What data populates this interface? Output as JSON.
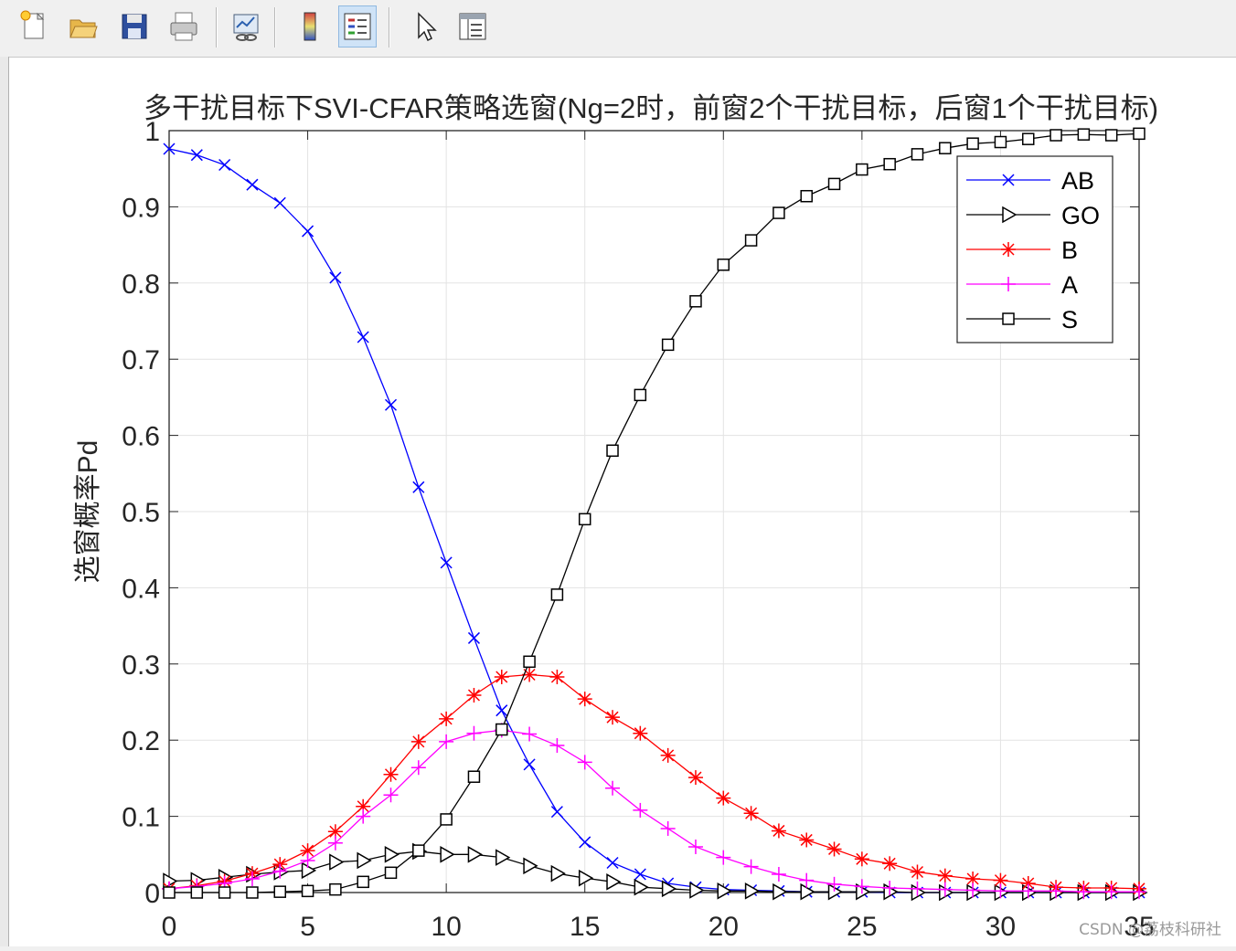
{
  "toolbar": {
    "buttons": [
      {
        "name": "new-figure-icon"
      },
      {
        "name": "open-file-icon"
      },
      {
        "name": "save-icon"
      },
      {
        "name": "print-icon"
      },
      {
        "name": "link-plot-icon"
      },
      {
        "name": "insert-colorbar-icon"
      },
      {
        "name": "insert-legend-icon",
        "active": true
      },
      {
        "name": "edit-plot-pointer-icon"
      },
      {
        "name": "property-inspector-icon"
      }
    ]
  },
  "watermark": "CSDN @荔枝科研社",
  "chart_data": {
    "type": "line",
    "title": "多干扰目标下SVI-CFAR策略选窗(Ng=2时，前窗2个干扰目标，后窗1个干扰目标)",
    "xlabel": "",
    "ylabel": "选窗概率Pd",
    "xlim": [
      0,
      35
    ],
    "ylim": [
      0,
      1
    ],
    "xticks": [
      0,
      5,
      10,
      15,
      20,
      25,
      30,
      35
    ],
    "yticks": [
      0,
      0.1,
      0.2,
      0.3,
      0.4,
      0.5,
      0.6,
      0.7,
      0.8,
      0.9,
      1
    ],
    "grid": true,
    "legend_position": "top-right",
    "x": [
      0,
      1,
      2,
      3,
      4,
      5,
      6,
      7,
      8,
      9,
      10,
      11,
      12,
      13,
      14,
      15,
      16,
      17,
      18,
      19,
      20,
      21,
      22,
      23,
      24,
      25,
      26,
      27,
      28,
      29,
      30,
      31,
      32,
      33,
      34,
      35
    ],
    "series": [
      {
        "name": "AB",
        "color": "#0000ff",
        "marker": "x",
        "values": [
          0.976,
          0.968,
          0.955,
          0.929,
          0.905,
          0.868,
          0.807,
          0.729,
          0.64,
          0.532,
          0.433,
          0.334,
          0.239,
          0.168,
          0.106,
          0.066,
          0.039,
          0.024,
          0.012,
          0.007,
          0.004,
          0.003,
          0.002,
          0.001,
          0.001,
          0.001,
          0.0,
          0.0,
          0.0,
          0.0,
          0.0,
          0.0,
          0.0,
          0.0,
          0.0,
          0.0
        ]
      },
      {
        "name": "GO",
        "color": "#000000",
        "marker": "triangle-right",
        "values": [
          0.015,
          0.016,
          0.02,
          0.024,
          0.027,
          0.029,
          0.04,
          0.042,
          0.05,
          0.054,
          0.05,
          0.05,
          0.046,
          0.035,
          0.025,
          0.019,
          0.014,
          0.007,
          0.005,
          0.003,
          0.002,
          0.002,
          0.001,
          0.001,
          0.001,
          0.001,
          0.001,
          0.0,
          0.0,
          0.0,
          0.0,
          0.0,
          0.0,
          0.0,
          0.0,
          0.0
        ]
      },
      {
        "name": "B",
        "color": "#ff0000",
        "marker": "asterisk",
        "values": [
          0.005,
          0.009,
          0.015,
          0.025,
          0.037,
          0.055,
          0.08,
          0.113,
          0.155,
          0.198,
          0.228,
          0.259,
          0.283,
          0.286,
          0.283,
          0.254,
          0.23,
          0.209,
          0.18,
          0.151,
          0.124,
          0.104,
          0.081,
          0.069,
          0.057,
          0.044,
          0.038,
          0.027,
          0.022,
          0.018,
          0.016,
          0.012,
          0.007,
          0.006,
          0.006,
          0.005
        ]
      },
      {
        "name": "A",
        "color": "#ff00ff",
        "marker": "plus",
        "values": [
          0.005,
          0.008,
          0.012,
          0.018,
          0.028,
          0.042,
          0.065,
          0.1,
          0.128,
          0.164,
          0.198,
          0.209,
          0.213,
          0.208,
          0.193,
          0.171,
          0.137,
          0.108,
          0.084,
          0.06,
          0.046,
          0.034,
          0.024,
          0.016,
          0.011,
          0.008,
          0.006,
          0.005,
          0.004,
          0.003,
          0.002,
          0.002,
          0.002,
          0.001,
          0.001,
          0.001
        ]
      },
      {
        "name": "S",
        "color": "#000000",
        "marker": "square",
        "values": [
          0.0,
          0.0,
          0.0,
          0.0,
          0.001,
          0.002,
          0.004,
          0.014,
          0.026,
          0.055,
          0.096,
          0.152,
          0.214,
          0.303,
          0.391,
          0.49,
          0.58,
          0.653,
          0.719,
          0.776,
          0.824,
          0.856,
          0.892,
          0.914,
          0.93,
          0.949,
          0.956,
          0.969,
          0.977,
          0.983,
          0.985,
          0.989,
          0.994,
          0.995,
          0.994,
          0.996
        ]
      }
    ]
  }
}
